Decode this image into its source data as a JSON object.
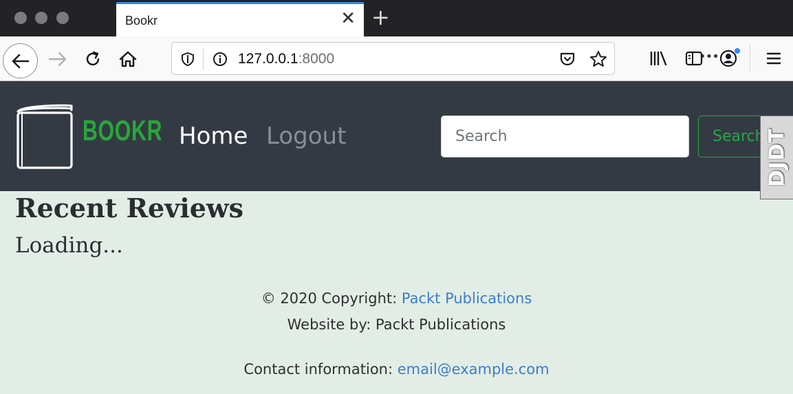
{
  "browser": {
    "tab_title": "Bookr",
    "tab_close_glyph": "✕",
    "new_tab_glyph": "+",
    "url_host": "127.0.0.1",
    "url_port": ":8000",
    "page_actions_glyph": "•••",
    "icons": [
      "back-arrow-icon",
      "forward-arrow-icon",
      "reload-icon",
      "home-icon",
      "shield-icon",
      "info-icon",
      "pocket-icon",
      "star-icon",
      "library-icon",
      "sidebar-icon",
      "account-icon",
      "hamburger-menu-icon"
    ]
  },
  "site": {
    "brand": "BOOKR",
    "nav": {
      "home": "Home",
      "logout": "Logout"
    },
    "search": {
      "placeholder": "Search",
      "button": "Search"
    },
    "debug_toolbar": "DJDT"
  },
  "main": {
    "title": "Recent Reviews",
    "status": "Loading..."
  },
  "footer": {
    "copyright_prefix": "© 2020 Copyright: ",
    "copyright_link": "Packt Publications",
    "website_by": "Website by: Packt Publications",
    "contact_prefix": "Contact information: ",
    "contact_email": "email@example.com"
  },
  "colors": {
    "header_bg": "#343a44",
    "brand_green": "#27a838",
    "page_bg": "#e2ede6",
    "link_blue": "#3d7fc8",
    "tab_accent": "#2f8cf5"
  }
}
